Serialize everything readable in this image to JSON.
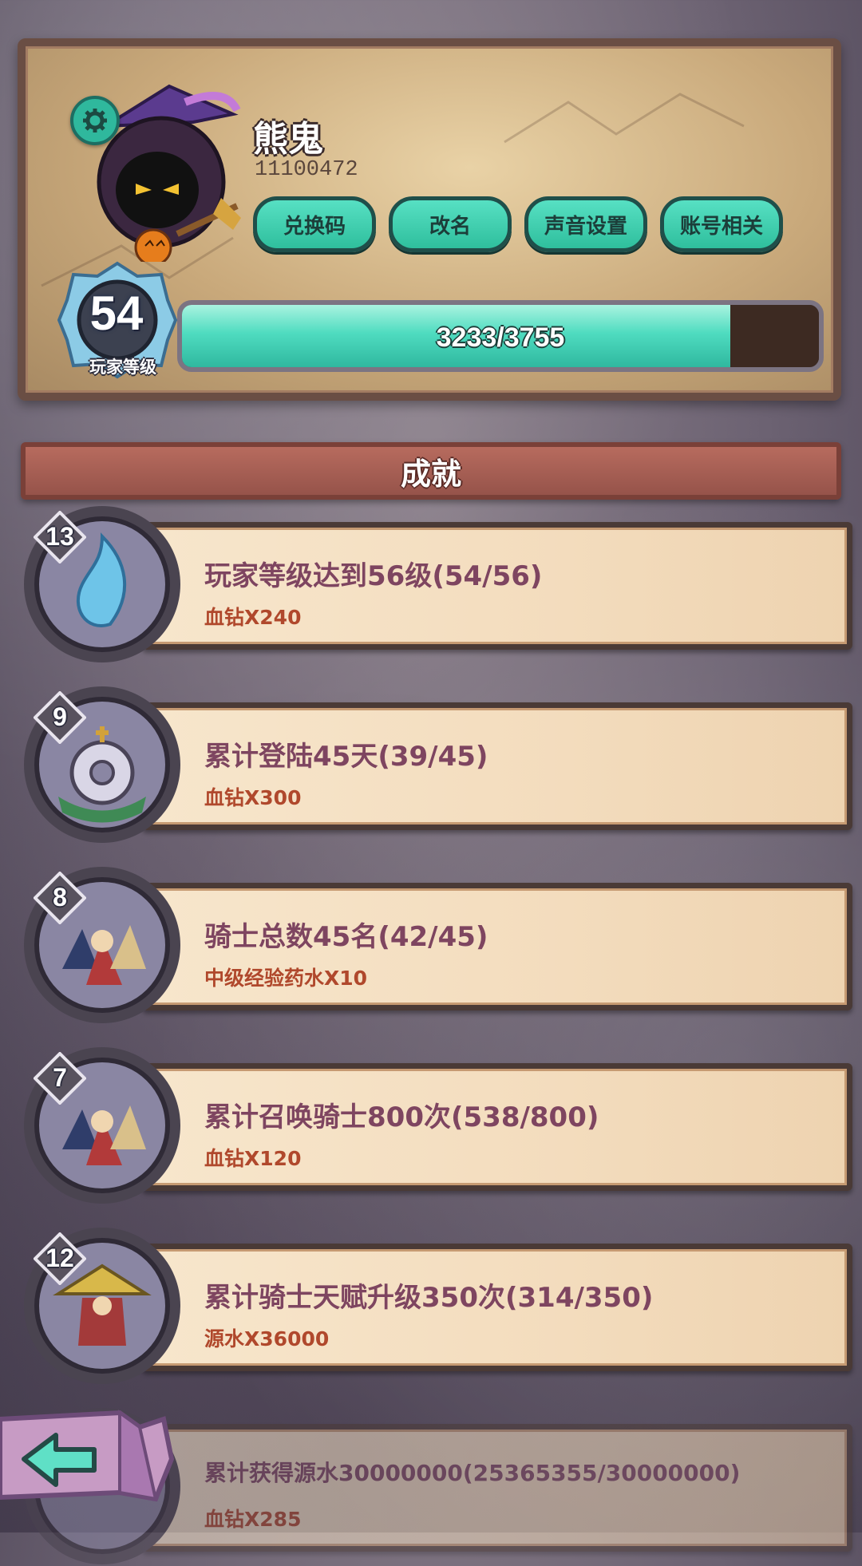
{
  "profile": {
    "name": "熊鬼",
    "id": "11100472",
    "buttons": [
      "兑换码",
      "改名",
      "声音设置",
      "账号相关"
    ],
    "level": "54",
    "level_label": "玩家等级",
    "xp_text": "3233/3755",
    "xp_progress": 0.861
  },
  "achievements": {
    "title": "成就",
    "items": [
      {
        "badge": "13",
        "title": "玩家等级达到56级(54/56)",
        "reward": "血钻X240",
        "icon": "blue-flame-icon"
      },
      {
        "badge": "9",
        "title": "累计登陆45天(39/45)",
        "reward": "血钻X300",
        "icon": "gear-crown-icon"
      },
      {
        "badge": "8",
        "title": "骑士总数45名(42/45)",
        "reward": "中级经验药水X10",
        "icon": "knights-group-icon"
      },
      {
        "badge": "7",
        "title": "累计召唤骑士800次(538/800)",
        "reward": "血钻X120",
        "icon": "knights-group-icon"
      },
      {
        "badge": "12",
        "title": "累计骑士天赋升级350次(314/350)",
        "reward": "源水X36000",
        "icon": "straw-hat-knight-icon"
      },
      {
        "badge": "",
        "title": "累计获得源水30000000(25365355/30000000)",
        "reward": "血钻X285",
        "icon": "hidden-icon"
      }
    ]
  },
  "colors": {
    "accent": "#2fbf9d",
    "title_text": "#7e4560",
    "reward_text": "#b0482c"
  }
}
